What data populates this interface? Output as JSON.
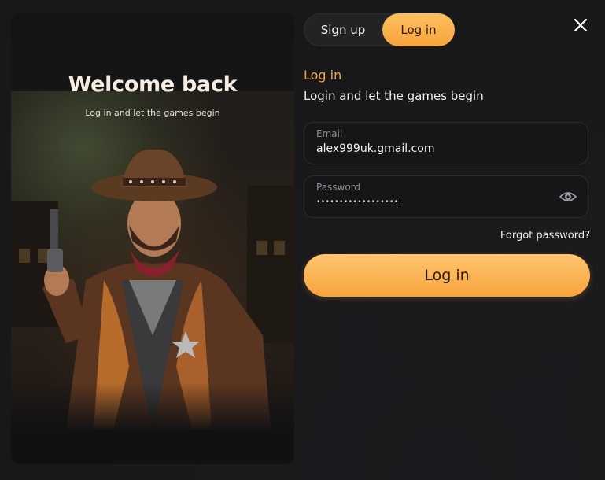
{
  "art_panel": {
    "title": "Welcome back",
    "subtitle": "Log in and let the games begin"
  },
  "tabs": {
    "signup_label": "Sign up",
    "login_label": "Log in",
    "active": "Log in"
  },
  "form": {
    "heading": "Log in",
    "subheading": "Login and let the games begin",
    "email": {
      "label": "Email",
      "value": "alex999uk.gmail.com"
    },
    "password": {
      "label": "Password",
      "value": "••••••••••••••••••"
    },
    "forgot_label": "Forgot password?",
    "submit_label": "Log in"
  },
  "icons": {
    "close": "close-icon",
    "eye": "eye-icon"
  },
  "colors": {
    "accent": "#f6a43c",
    "background": "#1b1b1e",
    "field_bg": "#161618"
  }
}
